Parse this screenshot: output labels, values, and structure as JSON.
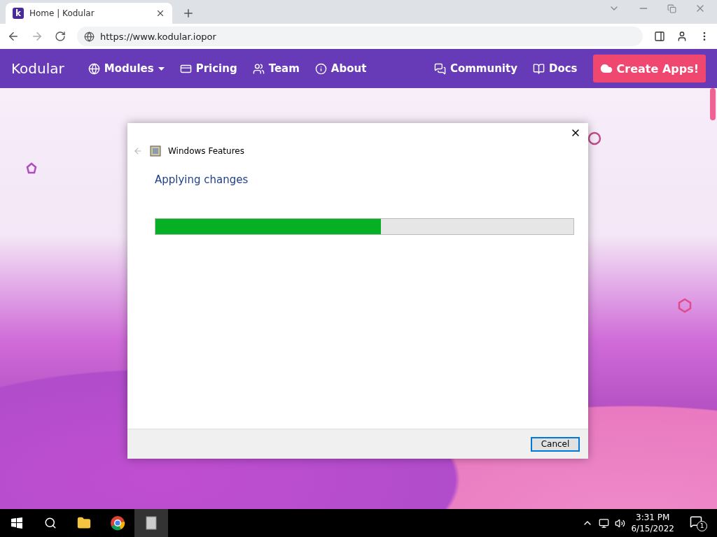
{
  "browser": {
    "tab": {
      "favicon": "k",
      "title": "Home | Kodular"
    },
    "address": "https://www.kodular.iopor"
  },
  "site_nav": {
    "brand": "Kodular",
    "items": [
      {
        "label": "Modules",
        "dropdown": true
      },
      {
        "label": "Pricing",
        "dropdown": false
      },
      {
        "label": "Team",
        "dropdown": false
      },
      {
        "label": "About",
        "dropdown": false
      }
    ],
    "right_items": [
      {
        "label": "Community"
      },
      {
        "label": "Docs"
      }
    ],
    "cta": "Create Apps!"
  },
  "dialog": {
    "title": "Windows Features",
    "heading": "Applying changes",
    "progress": {
      "level": 0.54
    },
    "buttons": [
      "Cancel"
    ]
  },
  "taskbar": {
    "time": "3:31 PM",
    "date": "6/15/2022",
    "notification_count": "1"
  }
}
